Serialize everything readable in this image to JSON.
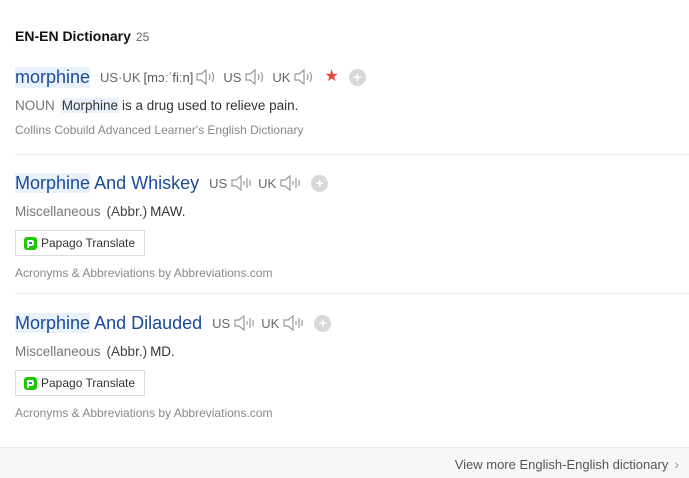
{
  "section": {
    "title": "EN-EN Dictionary",
    "count": "25"
  },
  "entries": [
    {
      "word": "morphine",
      "pron_uk_us_label": "US·UK",
      "ipa": "[mɔːˈfiːn]",
      "us_label": "US",
      "uk_label": "UK",
      "pos": "NOUN",
      "def_keyword": "Morphine",
      "def_rest": "is a drug used to relieve pain.",
      "source": "Collins Cobuild Advanced Learner's English Dictionary"
    },
    {
      "word_hl": "Morphine",
      "word_rest": "And Whiskey",
      "us_label": "US",
      "uk_label": "UK",
      "pos": "Miscellaneous",
      "abbr": "(Abbr.)",
      "def": "MAW.",
      "papago": "Papago Translate",
      "source": "Acronyms & Abbreviations by Abbreviations.com"
    },
    {
      "word_hl": "Morphine",
      "word_rest": "And Dilauded",
      "us_label": "US",
      "uk_label": "UK",
      "pos": "Miscellaneous",
      "abbr": "(Abbr.)",
      "def": "MD.",
      "papago": "Papago Translate",
      "source": "Acronyms & Abbreviations by Abbreviations.com"
    }
  ],
  "footer": {
    "more_link": "View more English-English dictionary"
  },
  "colors": {
    "accent_word": "#1a4a9c",
    "highlight": "#e9f2fb",
    "star": "#e8463c"
  },
  "icons": [
    "speaker-icon",
    "speaker-bars-icon",
    "star-icon",
    "plus-icon",
    "papago-icon",
    "chevron-right-icon"
  ]
}
